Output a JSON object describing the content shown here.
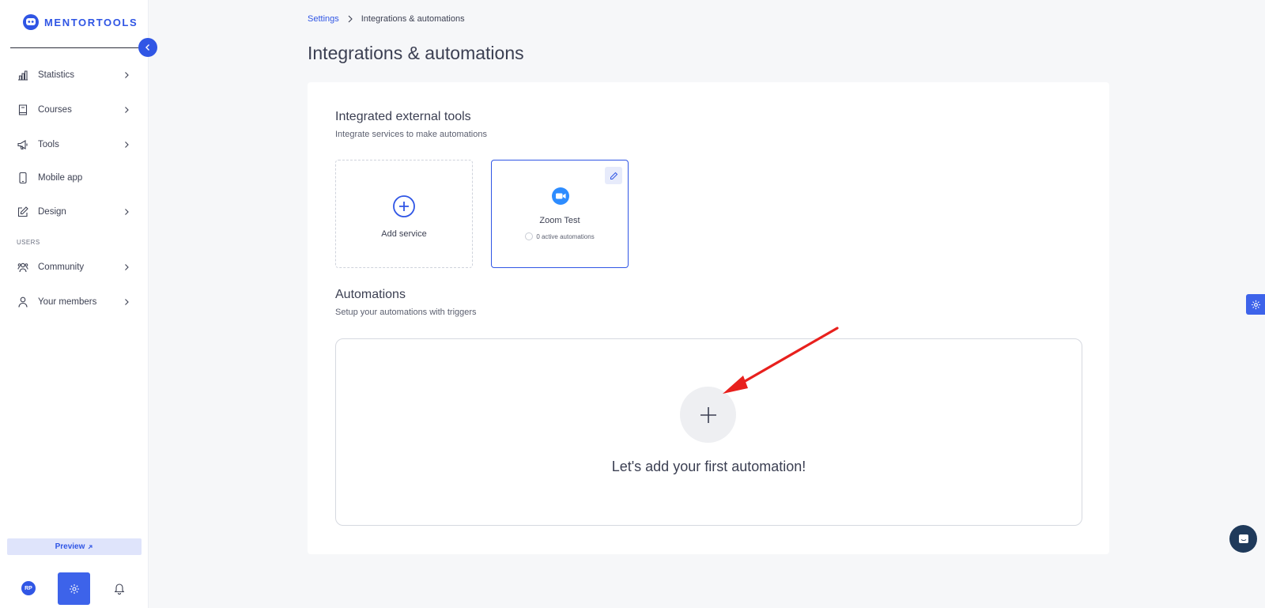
{
  "app": {
    "brand": "MENTORTOOLS",
    "accent_color": "#3056e5"
  },
  "sidebar": {
    "items": [
      {
        "label": "Statistics",
        "icon": "bar-chart-icon"
      },
      {
        "label": "Courses",
        "icon": "book-icon"
      },
      {
        "label": "Tools",
        "icon": "megaphone-icon"
      },
      {
        "label": "Mobile app",
        "icon": "phone-icon"
      },
      {
        "label": "Design",
        "icon": "pencil-square-icon"
      },
      {
        "label": "Community",
        "icon": "users-icon"
      },
      {
        "label": "Your members",
        "icon": "user-icon"
      }
    ],
    "section_users": "USERS",
    "preview_label": "Preview",
    "avatar_initials": "RP"
  },
  "breadcrumb": {
    "parent": "Settings",
    "current": "Integrations & automations"
  },
  "page": {
    "title": "Integrations & automations"
  },
  "integrations": {
    "title": "Integrated external tools",
    "subtitle": "Integrate services to make automations",
    "add_service_label": "Add service",
    "services": [
      {
        "name": "Zoom Test",
        "status": "0 active automations",
        "icon": "zoom-camera-icon"
      }
    ]
  },
  "automations": {
    "title": "Automations",
    "subtitle": "Setup your automations with triggers",
    "empty_text": "Let's add your first automation!"
  }
}
